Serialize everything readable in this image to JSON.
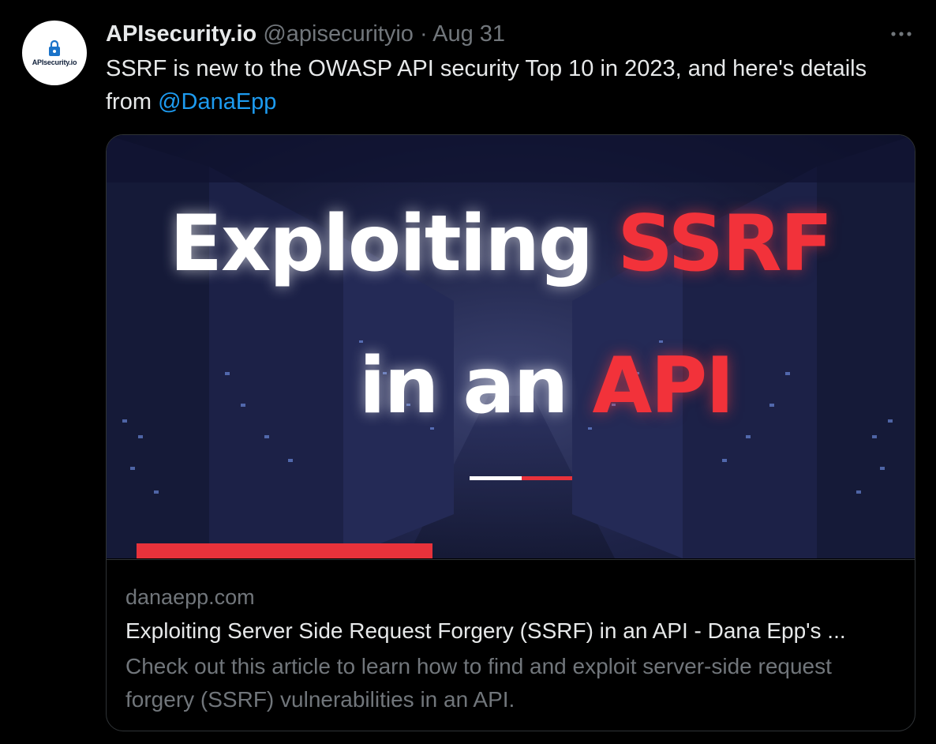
{
  "tweet": {
    "author_name": "APIsecurity.io",
    "handle": "@apisecurityio",
    "separator": "·",
    "date": "Aug 31",
    "avatar_text": "APIsecurity.io",
    "text_before_mention": "SSRF is new to the OWASP API security Top 10 in 2023, and here's details from ",
    "mention": "@DanaEpp",
    "more_icon": "more-horizontal-icon"
  },
  "card": {
    "image": {
      "line1_white": "Exploiting",
      "line1_red": "SSRF",
      "line2_white": "in an",
      "line2_red": "API"
    },
    "domain": "danaepp.com",
    "title": "Exploiting Server Side Request Forgery (SSRF) in an API - Dana Epp's ...",
    "description": "Check out this article to learn how to find and exploit server-side request forgery (SSRF) vulnerabilities in an API."
  },
  "colors": {
    "background": "#000000",
    "text": "#e7e9ea",
    "secondary": "#71767b",
    "link": "#1d9bf0",
    "accent_red": "#f2323a",
    "border": "#2f3336"
  }
}
